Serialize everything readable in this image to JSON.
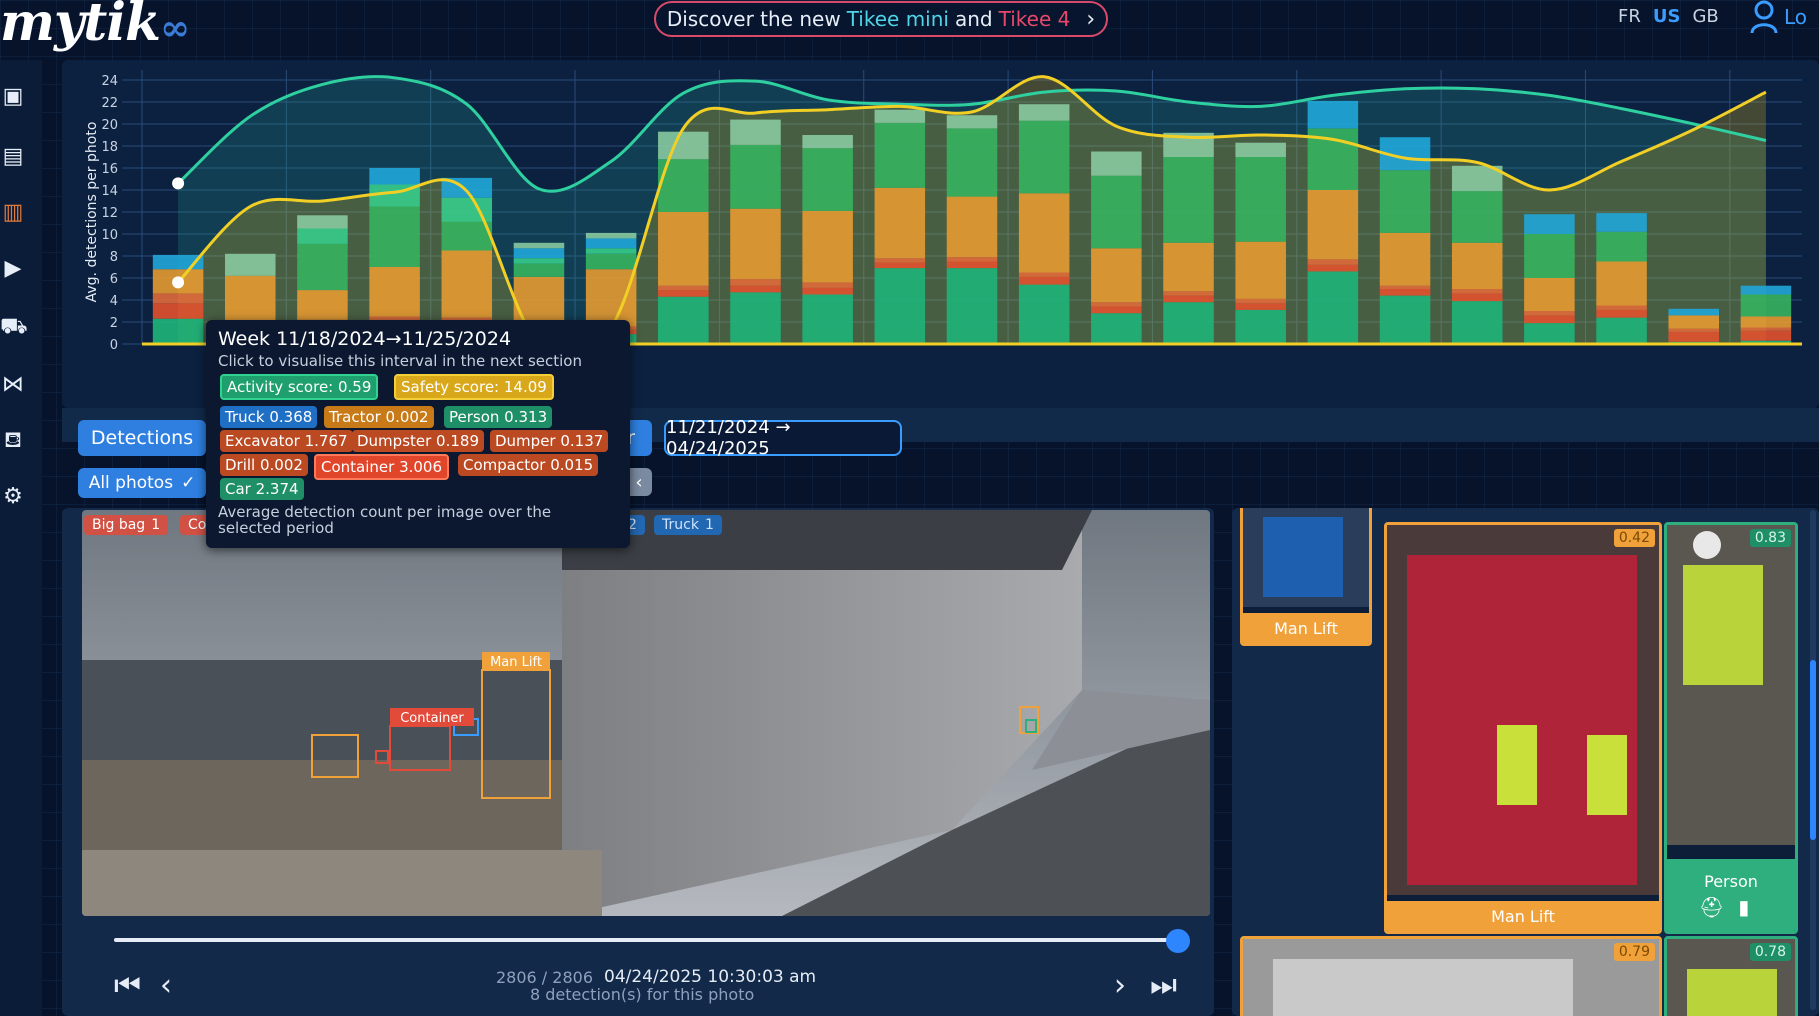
{
  "header": {
    "logo_prefix": "my",
    "logo_main": "tik",
    "promo_a": "Discover the new",
    "promo_mini": "Tikee mini",
    "promo_and": "and",
    "promo_t4": "Tikee 4",
    "langs": [
      "FR",
      "US",
      "GB"
    ],
    "active_lang": "US",
    "login_label": "Lo"
  },
  "chart_data": {
    "type": "bar",
    "ylabel": "Avg. detections per photo",
    "ylim": [
      0,
      24
    ],
    "yticks": [
      0,
      2,
      4,
      6,
      8,
      10,
      12,
      14,
      16,
      18,
      20,
      22,
      24
    ],
    "stack_colors": [
      "#1eb57a",
      "#e2512e",
      "#e06a3a",
      "#e59a32",
      "#36b35f",
      "#36cc8a",
      "#20a6d8",
      "#88c9a0"
    ],
    "stacks": [
      [
        2.3,
        1.4,
        0.9,
        2.2,
        0,
        0,
        1.3,
        0
      ],
      [
        0.6,
        0.3,
        0.3,
        5.0,
        0,
        0,
        0,
        2.0
      ],
      [
        1.2,
        0.6,
        0.4,
        2.7,
        4.2,
        1.4,
        0,
        1.2
      ],
      [
        1.6,
        0.5,
        0.4,
        4.5,
        5.5,
        2.0,
        1.5,
        0
      ],
      [
        1.2,
        0.8,
        0.4,
        6.1,
        2.6,
        2.2,
        1.8,
        0
      ],
      [
        0.6,
        0.6,
        0.3,
        4.6,
        1.2,
        0.5,
        0.9,
        0.5
      ],
      [
        0.9,
        0.4,
        0.3,
        5.2,
        1.4,
        0.5,
        0.9,
        0.5
      ],
      [
        4.3,
        0.6,
        0.4,
        6.7,
        4.8,
        0,
        0,
        2.5
      ],
      [
        4.7,
        0.6,
        0.6,
        6.4,
        5.8,
        0,
        0,
        2.3
      ],
      [
        4.5,
        0.6,
        0.5,
        6.5,
        5.7,
        0,
        0,
        1.2
      ],
      [
        6.9,
        0.5,
        0.4,
        6.4,
        5.9,
        0,
        0,
        1.2
      ],
      [
        6.9,
        0.6,
        0.4,
        5.5,
        6.2,
        0,
        0,
        1.2
      ],
      [
        5.4,
        0.7,
        0.4,
        7.2,
        6.6,
        0,
        0,
        1.5
      ],
      [
        2.8,
        0.6,
        0.4,
        4.9,
        6.6,
        0,
        0,
        2.2
      ],
      [
        3.8,
        0.6,
        0.4,
        4.4,
        7.8,
        0,
        0,
        2.2
      ],
      [
        3.1,
        0.6,
        0.4,
        5.2,
        7.7,
        0,
        0,
        1.3
      ],
      [
        6.6,
        0.6,
        0.5,
        6.3,
        5.6,
        0,
        2.5,
        0
      ],
      [
        4.4,
        0.6,
        0.3,
        4.8,
        5.7,
        0,
        3.0,
        0
      ],
      [
        3.9,
        0.7,
        0.4,
        4.2,
        4.7,
        0,
        0,
        2.3
      ],
      [
        1.9,
        0.7,
        0.4,
        3.0,
        4.0,
        0,
        1.8,
        0
      ],
      [
        2.4,
        0.7,
        0.4,
        4.0,
        2.7,
        0,
        1.7,
        0
      ],
      [
        0.2,
        0.9,
        0.3,
        1.2,
        0,
        0,
        0.6,
        0
      ],
      [
        0.3,
        0.9,
        0.3,
        1.0,
        2.0,
        0,
        0.8,
        0
      ]
    ],
    "activity_line": [
      14.6,
      20.7,
      23.6,
      24.2,
      21.8,
      14.1,
      16.6,
      22.8,
      23.9,
      22.2,
      21.8,
      21.8,
      22.9,
      23.0,
      22.0,
      21.6,
      22.6,
      23.2,
      23.2,
      22.6,
      21.4,
      20.0,
      18.5
    ],
    "safety_line": [
      5.6,
      12.5,
      13.0,
      13.8,
      13.9,
      0,
      1.5,
      19.6,
      21.0,
      21.3,
      21.6,
      21.1,
      24.3,
      19.8,
      18.8,
      19.0,
      18.6,
      16.9,
      16.5,
      14.0,
      16.6,
      19.5,
      22.9
    ]
  },
  "tooltip": {
    "title": "Week 11/18/2024→11/25/2024",
    "subtitle": "Click to visualise this interval in the next section",
    "activity": "Activity score: 0.59",
    "safety": "Safety score: 14.09",
    "pills": [
      [
        "Truck 0.368",
        "#1f6fc4"
      ],
      [
        "Tractor 0.002",
        "#c87a18"
      ],
      [
        "Person 0.313",
        "#1f8f68"
      ],
      [
        "Excavator 1.767",
        "#bb4a23"
      ],
      [
        "Dumpster 0.189",
        "#bb4a23"
      ],
      [
        "Dumper 0.137",
        "#bb4a23"
      ],
      [
        "Drill 0.002",
        "#bb4a23"
      ],
      [
        "Container 3.006",
        "#e2462a"
      ],
      [
        "Compactor 0.015",
        "#bb4a23"
      ],
      [
        "Car 2.374",
        "#1f8f68"
      ]
    ],
    "footer": "Average detection count per image over the selected period"
  },
  "controls": {
    "detections_tab": "Detections",
    "hidden_tab": "r",
    "date_range": "11/21/2024 → 04/24/2025",
    "all_photos": "All photos"
  },
  "viewer": {
    "tags": [
      [
        "Big bag",
        "1",
        "#e24a3a"
      ],
      [
        "Co",
        "",
        "#e24a3a"
      ],
      [
        "2",
        "",
        "#1f6fc4"
      ],
      [
        "Truck",
        "1",
        "#1f6fc4"
      ]
    ],
    "box_labels": [
      "Man Lift",
      "Container"
    ],
    "counter": "2806 / 2806",
    "timestamp": "04/24/2025 10:30:03 am",
    "detections": "8  detection(s) for this photo"
  },
  "gallery": {
    "cards": [
      [
        "Man Lift",
        ""
      ],
      [
        "Man Lift",
        "0.42"
      ],
      [
        "Person",
        "0.83"
      ],
      [
        "",
        "0.79"
      ],
      [
        "",
        "0.78"
      ]
    ]
  }
}
